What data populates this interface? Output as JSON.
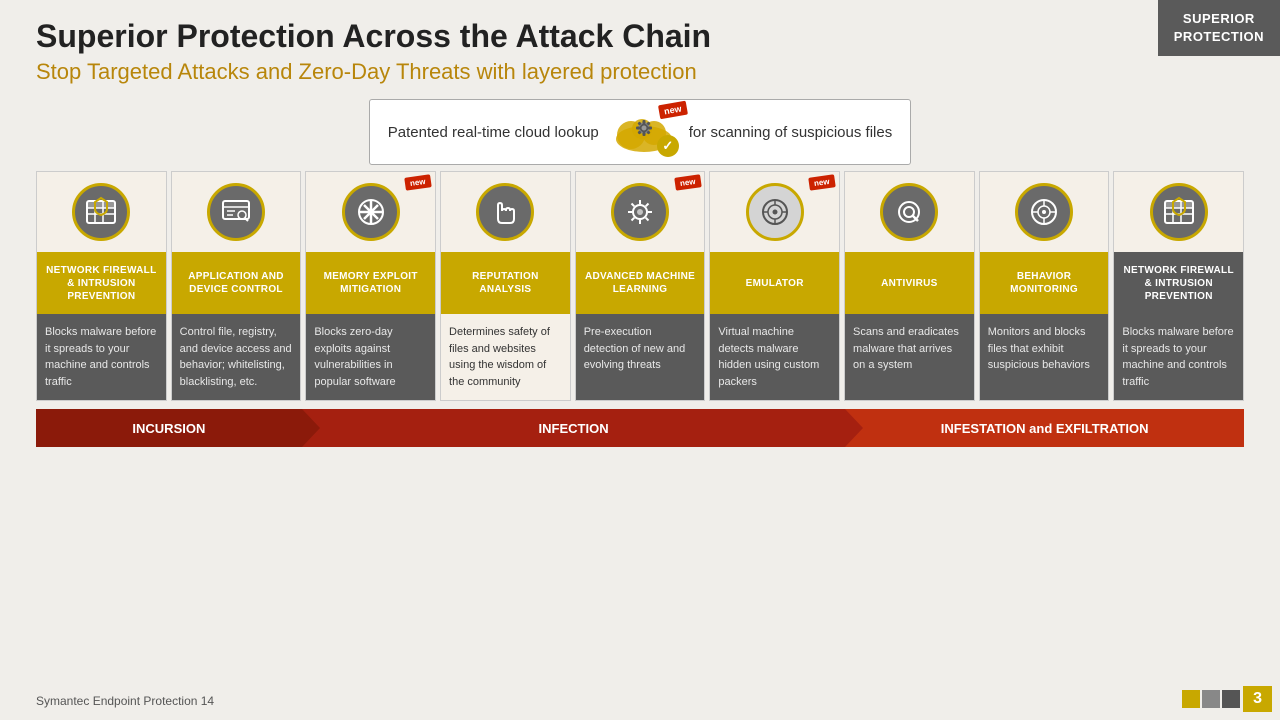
{
  "badge": {
    "line1": "SUPERIOR",
    "line2": "PROTECTION"
  },
  "header": {
    "title": "Superior Protection Across the Attack Chain",
    "subtitle": "Stop Targeted Attacks and Zero-Day Threats with layered protection"
  },
  "cloudLookup": {
    "preText": "Patented real-time cloud lookup",
    "postText": "for scanning of suspicious files",
    "newLabel": "new"
  },
  "columns": [
    {
      "id": "network-firewall-1",
      "title": "NETWORK FIREWALL & INTRUSION PREVENTION",
      "desc": "Blocks malware before it spreads to your machine and controls traffic",
      "isNew": false,
      "titleDark": false,
      "descLight": false,
      "icon": "🛡"
    },
    {
      "id": "app-device-control",
      "title": "APPLICATION AND DEVICE CONTROL",
      "desc": "Control file, registry, and device access and behavior; whitelisting, blacklisting, etc.",
      "isNew": false,
      "titleDark": false,
      "descLight": false,
      "icon": "📊"
    },
    {
      "id": "memory-exploit",
      "title": "MEMORY EXPLOIT MITIGATION",
      "desc": "Blocks zero-day exploits against vulnerabilities in popular software",
      "isNew": true,
      "titleDark": false,
      "descLight": false,
      "icon": "⚔"
    },
    {
      "id": "reputation-analysis",
      "title": "REPUTATION ANALYSIS",
      "desc": "Determines safety of files and websites using the wisdom of the community",
      "isNew": false,
      "titleDark": false,
      "descLight": true,
      "icon": "✋"
    },
    {
      "id": "advanced-ml",
      "title": "ADVANCED MACHINE LEARNING",
      "desc": "Pre-execution detection of new and evolving threats",
      "isNew": true,
      "titleDark": false,
      "descLight": false,
      "icon": "⚙"
    },
    {
      "id": "emulator",
      "title": "EMULATOR",
      "desc": "Virtual machine detects malware hidden using custom packers",
      "isNew": true,
      "titleDark": false,
      "descLight": false,
      "icon": "🎯"
    },
    {
      "id": "antivirus",
      "title": "ANTIVIRUS",
      "desc": "Scans and eradicates malware that arrives on a system",
      "isNew": false,
      "titleDark": false,
      "descLight": false,
      "icon": "🔍"
    },
    {
      "id": "behavior-monitoring",
      "title": "BEHAVIOR MONITORING",
      "desc": "Monitors and blocks files that exhibit suspicious behaviors",
      "isNew": false,
      "titleDark": false,
      "descLight": false,
      "icon": "📡"
    },
    {
      "id": "network-firewall-2",
      "title": "NETWORK FIREWALL & INTRUSION PREVENTION",
      "desc": "Blocks malware before it spreads to your machine and controls traffic",
      "isNew": false,
      "titleDark": true,
      "descLight": false,
      "icon": "🛡"
    }
  ],
  "attackChain": {
    "incursion": "INCURSION",
    "infection": "INFECTION",
    "infestation": "INFESTATION and EXFILTRATION"
  },
  "footer": {
    "text": "Symantec Endpoint Protection 14",
    "pageNum": "3"
  },
  "newLabel": "new"
}
